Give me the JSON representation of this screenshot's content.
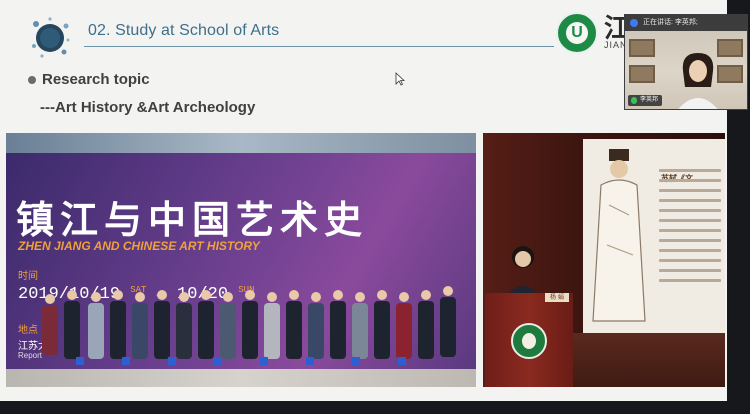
{
  "slide": {
    "title": "02. Study at School of Arts",
    "bullet_heading": "Research topic",
    "bullet_sub": "---Art History &Art Archeology",
    "university_name": "江苏大学",
    "university_sub": "JIANGSU"
  },
  "banner": {
    "title_cn": "镇江与中国艺术史",
    "title_en": "ZHEN JIANG AND CHINESE ART HISTORY",
    "time_label": "时间",
    "date_start": "2019/10/19",
    "date_start_wk": "SAT",
    "date_end": "10/20",
    "date_end_wk": "SUN",
    "place_label": "地点",
    "place_text": "江苏大",
    "report_text": "Report"
  },
  "lecture": {
    "slide_heading": "苏轼《文",
    "podium_sign": "杨  娟"
  },
  "video": {
    "speaking_label": "正在讲话: 李英邦;",
    "participant_name": "李英邦"
  },
  "colors": {
    "title": "#3f6f8a",
    "banner_purple": "#6a3f8e",
    "banner_orange": "#f0a03c",
    "uni_green": "#1f8a46"
  }
}
